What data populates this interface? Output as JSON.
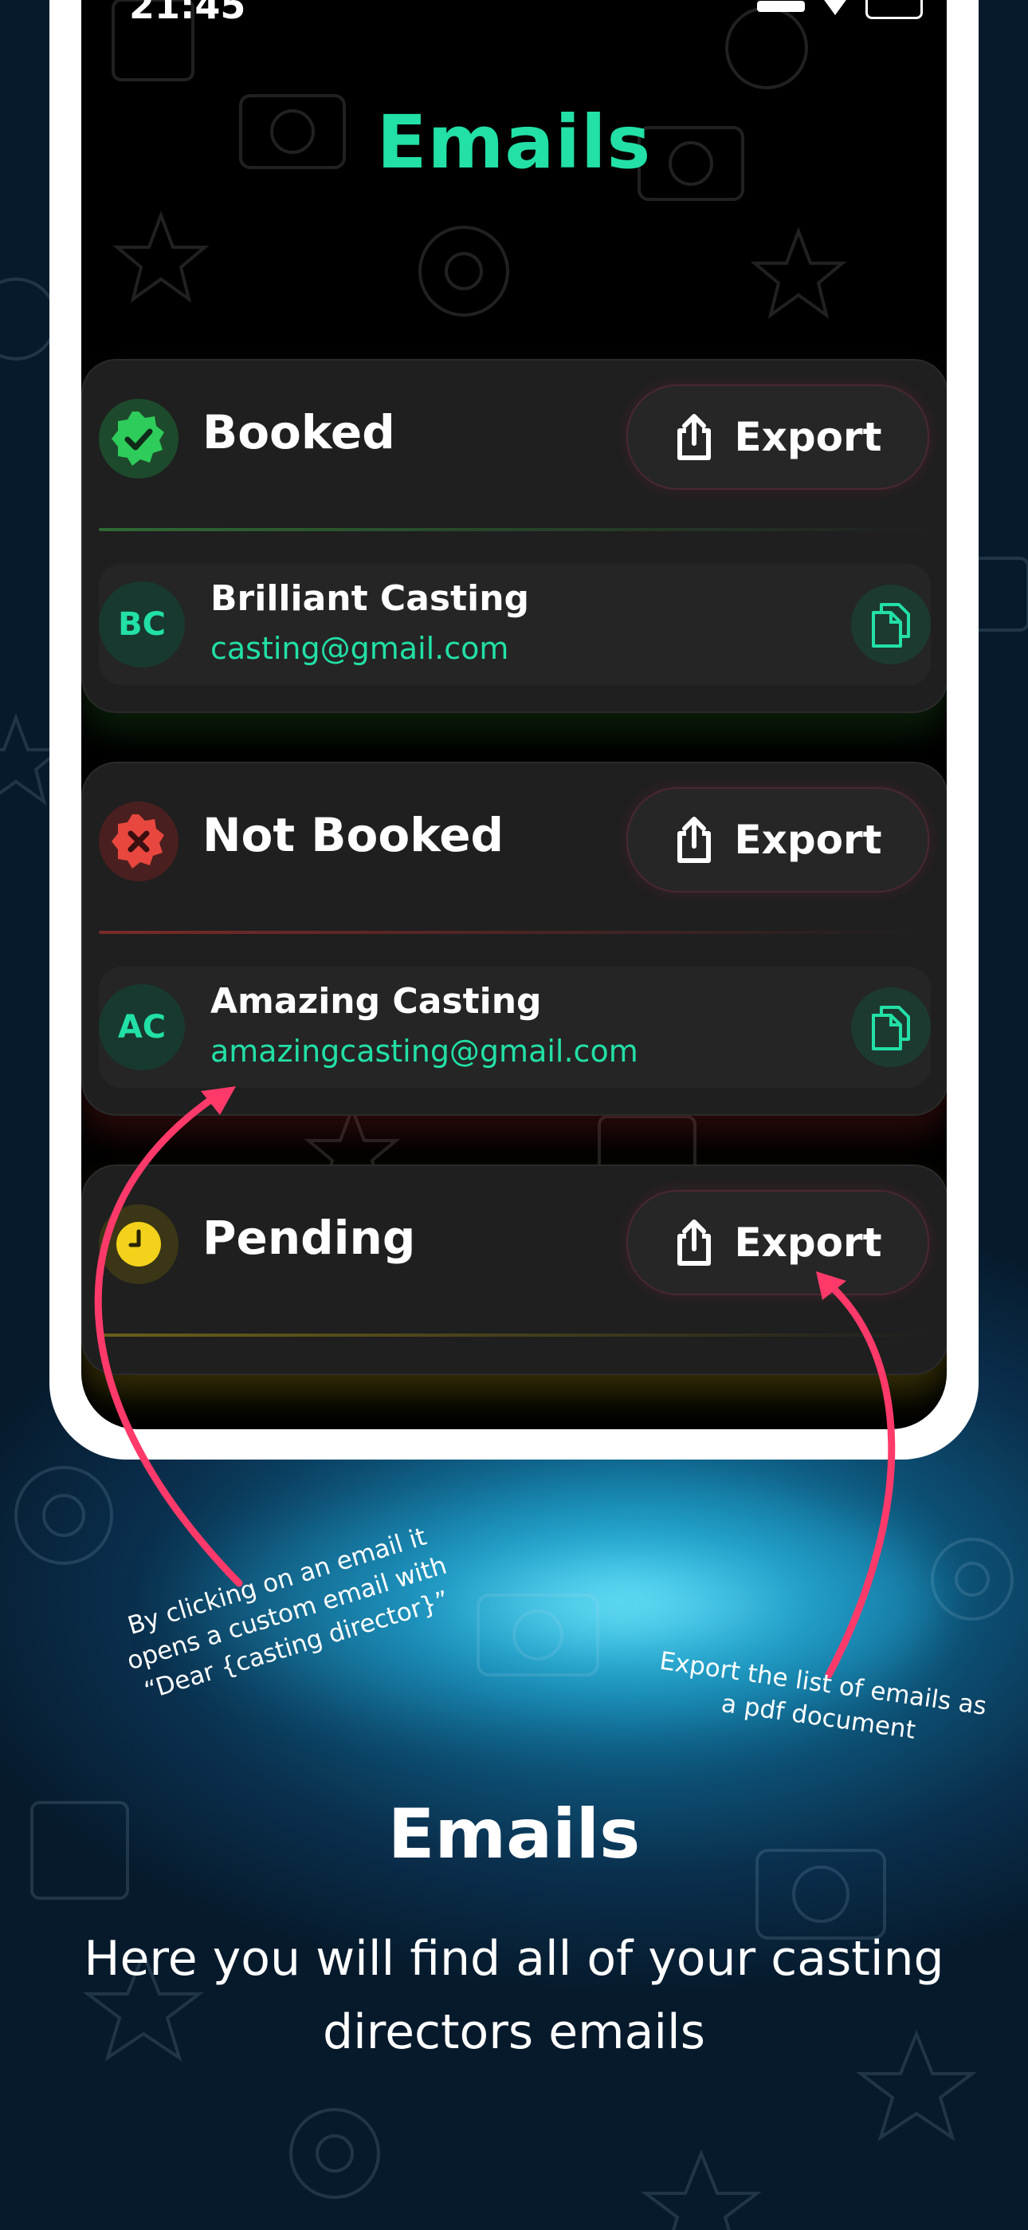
{
  "status_bar": {
    "time": "21:45"
  },
  "screen": {
    "title": "Emails",
    "sections": [
      {
        "title": "Booked",
        "export_label": "Export",
        "accent": "#2ecc5a",
        "emails": [
          {
            "initials": "BC",
            "name": "Brilliant Casting",
            "email": "casting@gmail.com"
          }
        ]
      },
      {
        "title": "Not Booked",
        "export_label": "Export",
        "accent": "#e8473f",
        "emails": [
          {
            "initials": "AC",
            "name": "Amazing Casting",
            "email": "amazingcasting@gmail.com"
          }
        ]
      },
      {
        "title": "Pending",
        "export_label": "Export",
        "accent": "#f2d21b",
        "emails": []
      }
    ]
  },
  "annotations": {
    "left": "By clicking on an email it opens a custom email with “Dear {casting director}”",
    "right": "Export the list of emails as a pdf document"
  },
  "footer": {
    "title": "Emails",
    "subtitle": "Here you will find all of your casting directors emails"
  },
  "colors": {
    "accent_green": "#22e0a6",
    "arrow": "#ff3a6a",
    "background": "#0a2f4d"
  },
  "icons": [
    "verified-badge-icon",
    "reject-badge-icon",
    "clock-icon",
    "share-export-icon",
    "copy-icon"
  ]
}
